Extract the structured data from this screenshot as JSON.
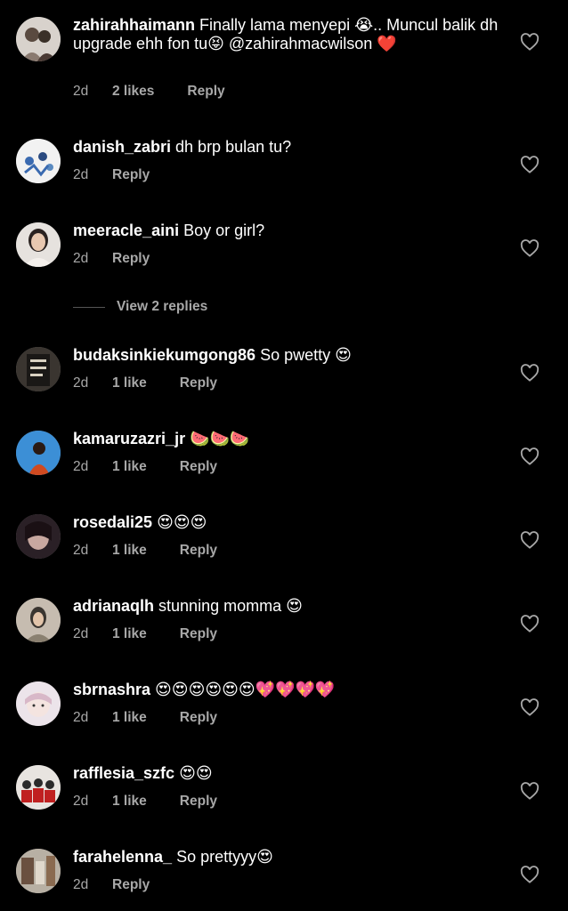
{
  "comments": [
    {
      "username": "zahirahhaimann",
      "text": "Finally lama menyepi 😭.. Muncul balik dh upgrade ehh fon tu😝 @zahirahmacwilson ❤️",
      "time": "2d",
      "likes": "2 likes",
      "reply": "Reply",
      "avatar_colors": [
        "#d8d2cc",
        "#5a4a40"
      ]
    },
    {
      "username": "danish_zabri",
      "text": "dh brp bulan tu?",
      "time": "2d",
      "likes": "",
      "reply": "Reply",
      "avatar_colors": [
        "#f2f2f2",
        "#3a6ab0"
      ]
    },
    {
      "username": "meeracle_aini",
      "text": "Boy or girl?",
      "time": "2d",
      "likes": "",
      "reply": "Reply",
      "avatar_colors": [
        "#e6e2de",
        "#2a2220"
      ]
    },
    {
      "username": "budaksinkiekumgong86",
      "text": "So pwetty 😍",
      "time": "2d",
      "likes": "1 like",
      "reply": "Reply",
      "avatar_colors": [
        "#3a3530",
        "#d8d0c0"
      ]
    },
    {
      "username": "kamaruzazri_jr",
      "text": "🍉🍉🍉",
      "time": "2d",
      "likes": "1 like",
      "reply": "Reply",
      "avatar_colors": [
        "#3c8fd6",
        "#d04a20"
      ]
    },
    {
      "username": "rosedali25",
      "text": "😍😍😍",
      "time": "2d",
      "likes": "1 like",
      "reply": "Reply",
      "avatar_colors": [
        "#2a2026",
        "#c8a8a0"
      ]
    },
    {
      "username": "adrianaqlh",
      "text": "stunning momma 😍",
      "time": "2d",
      "likes": "1 like",
      "reply": "Reply",
      "avatar_colors": [
        "#c6bcb0",
        "#3a3530"
      ]
    },
    {
      "username": "sbrnashra",
      "text": "😍😍😍😍😍😍💖💖💖💖",
      "time": "2d",
      "likes": "1 like",
      "reply": "Reply",
      "avatar_colors": [
        "#ece4ea",
        "#d8b8c8"
      ]
    },
    {
      "username": "rafflesia_szfc",
      "text": "😍😍",
      "time": "2d",
      "likes": "1 like",
      "reply": "Reply",
      "avatar_colors": [
        "#e8e4e0",
        "#2a2a2a"
      ]
    },
    {
      "username": "farahelenna_",
      "text": "So prettyyy😍",
      "time": "2d",
      "likes": "",
      "reply": "Reply",
      "avatar_colors": [
        "#b8b0a4",
        "#6a5040"
      ]
    }
  ],
  "view_replies": "View 2 replies"
}
